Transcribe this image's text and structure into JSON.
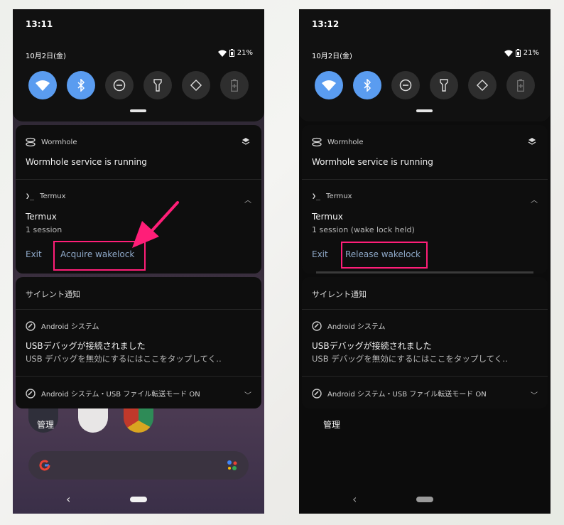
{
  "left": {
    "time": "13:11",
    "date": "10月2日(金)",
    "battery": "21%",
    "wormhole": {
      "app": "Wormhole",
      "title": "Wormhole service is running"
    },
    "termux": {
      "app": "Termux",
      "title": "Termux",
      "subtitle": "1 session",
      "exit": "Exit",
      "wake_action": "Acquire wakelock"
    },
    "silent": "サイレント通知",
    "android": {
      "app": "Android システム",
      "title": "USBデバッグが接続されました",
      "subtitle": "USB デバッグを無効にするにはここをタップしてく‥"
    },
    "usb": "Android システム・USB ファイル転送モード ON",
    "home_label": "管理"
  },
  "right": {
    "time": "13:12",
    "date": "10月2日(金)",
    "battery": "21%",
    "wormhole": {
      "app": "Wormhole",
      "title": "Wormhole service is running"
    },
    "termux": {
      "app": "Termux",
      "title": "Termux",
      "subtitle": "1 session (wake lock held)",
      "exit": "Exit",
      "wake_action": "Release wakelock"
    },
    "silent": "サイレント通知",
    "android": {
      "app": "Android システム",
      "title": "USBデバッグが接続されました",
      "subtitle": "USB デバッグを無効にするにはここをタップしてく‥"
    },
    "usb": "Android システム・USB ファイル転送モード ON",
    "home_label": "管理"
  },
  "icons": {
    "tiles": [
      "wifi-icon",
      "bluetooth-icon",
      "do-not-disturb-icon",
      "flashlight-icon",
      "auto-rotate-icon",
      "battery-saver-icon"
    ],
    "wormhole": "wormhole-icon",
    "termux": "terminal-icon",
    "android": "android-system-icon",
    "expand": "chevron-up-icon",
    "collapse": "chevron-down-icon",
    "layers": "layers-icon"
  },
  "colors": {
    "tile_active": "#5a9cf0",
    "tile_inactive": "#2e2e2e",
    "action_text": "#8fa9c9",
    "highlight": "#ff1e78"
  }
}
